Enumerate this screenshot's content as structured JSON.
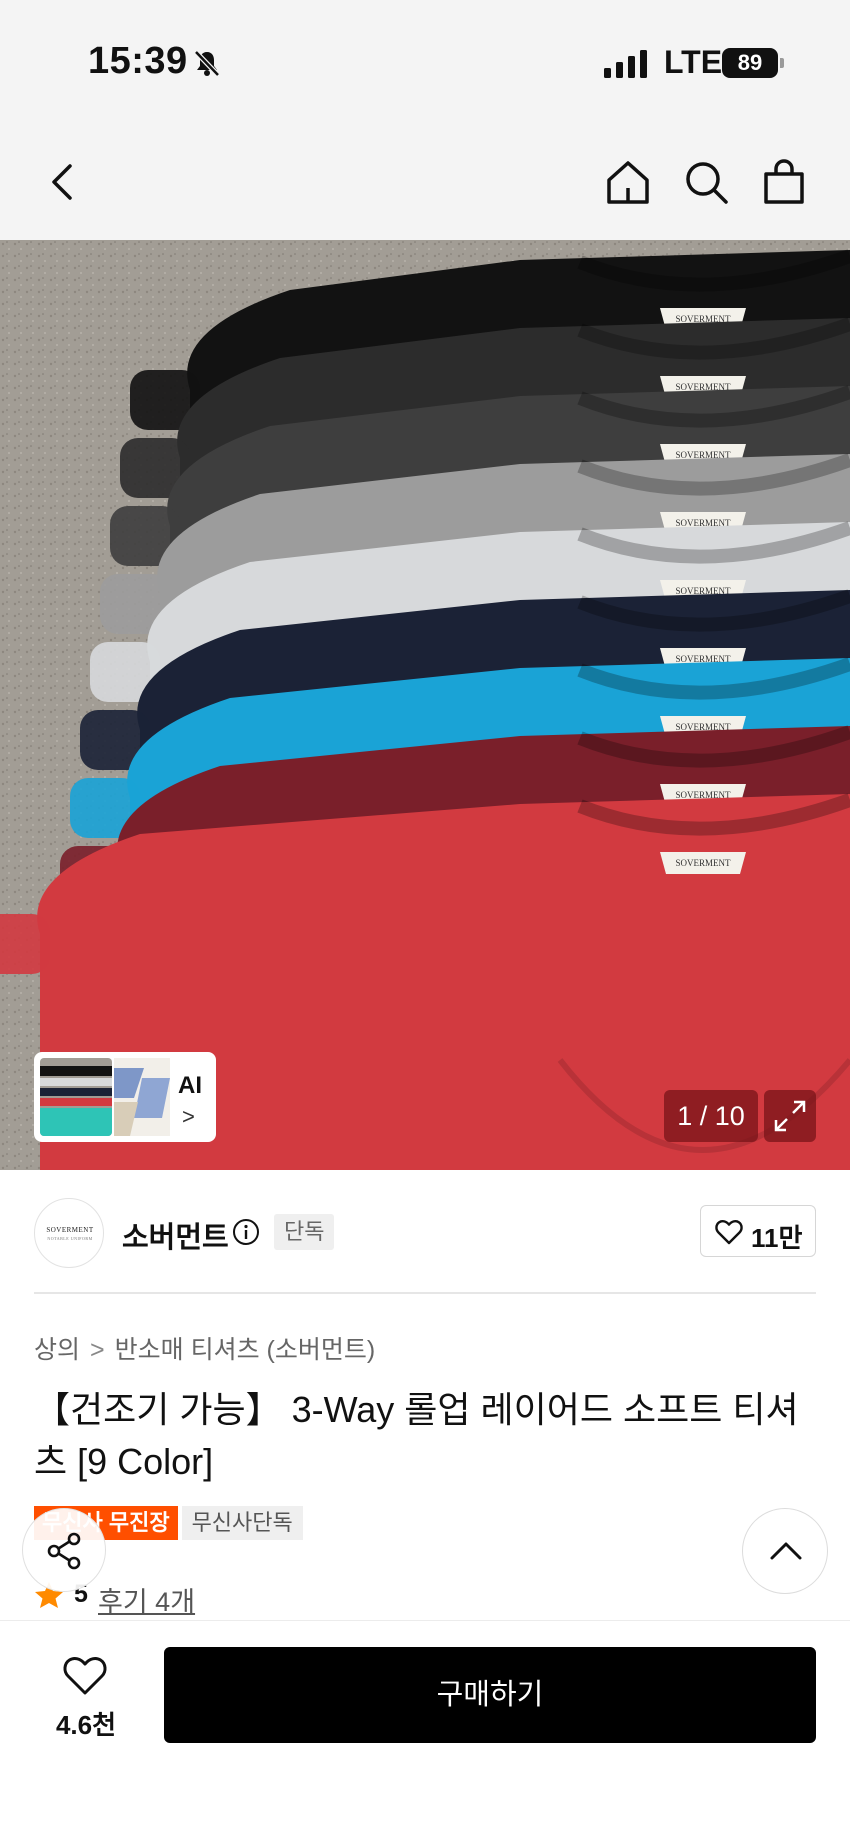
{
  "status_bar": {
    "time": "15:39",
    "network": "LTE",
    "battery": "89"
  },
  "nav": {
    "icons": [
      "back-icon",
      "home-icon",
      "search-icon",
      "shopping-bag-icon"
    ]
  },
  "hero": {
    "counter": "1 / 10",
    "ai_label": "AI",
    "ai_chevron": ">",
    "shirt_colors": [
      "#121212",
      "#2c2c2c",
      "#3e3e3e",
      "#9c9c9c",
      "#d7d9db",
      "#1b2236",
      "#1aa3d6",
      "#7a1f2a",
      "#d23a40"
    ],
    "label_text": "SOVERMENT"
  },
  "brand": {
    "logo_text": "SOVERMENT",
    "logo_subtext": "NOTABLE UNIFORM",
    "name": "소버먼트",
    "tag": "단독",
    "like_count": "11만"
  },
  "breadcrumb": {
    "level1": "상의",
    "separator": ">",
    "level2": "반소매 티셔츠 (소버먼트)"
  },
  "product": {
    "title": "【건조기 가능】 3-Way 롤업 레이어드 소프트 티셔츠 [9 Color]",
    "badges": {
      "primary": "무신사 무진장",
      "secondary": "무신사단독"
    },
    "rating": "5",
    "review_link": "후기 4개"
  },
  "bottom": {
    "wish_count": "4.6천",
    "buy_label": "구매하기"
  },
  "colors": {
    "accent_orange": "#ff4f00",
    "buy_button": "#000000"
  }
}
